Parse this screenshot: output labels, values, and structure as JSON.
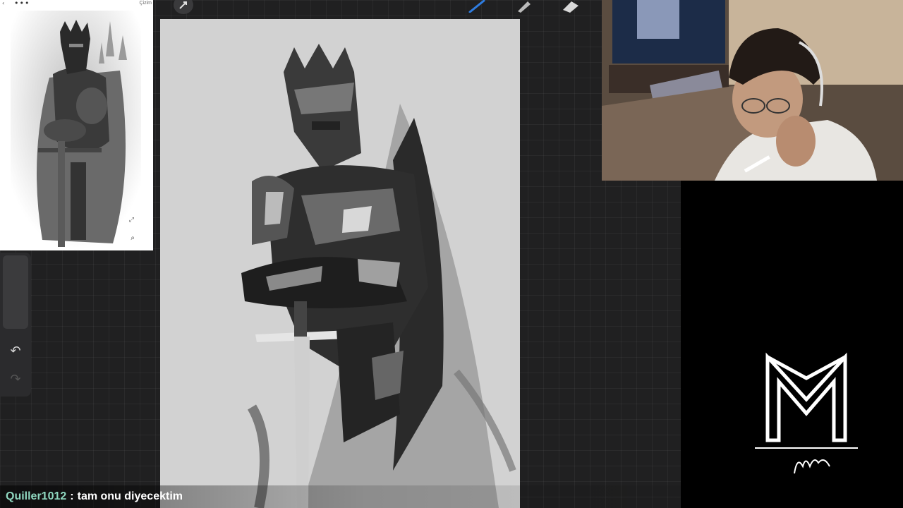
{
  "reference_panel": {
    "title": "Çizim",
    "menu_label": "•••",
    "back_label": "‹"
  },
  "toolbar": {
    "tools": [
      "gesture-icon",
      "brush-icon",
      "smudge-icon",
      "eraser-icon"
    ],
    "active_brush_color": "#2f7de1"
  },
  "sidebar": {
    "undo_label": "↶",
    "redo_label": "↷"
  },
  "chat": {
    "username": "Quiller1012",
    "separator": ":",
    "message": "tam onu diyecektim",
    "username_color": "#8fd8c0"
  }
}
